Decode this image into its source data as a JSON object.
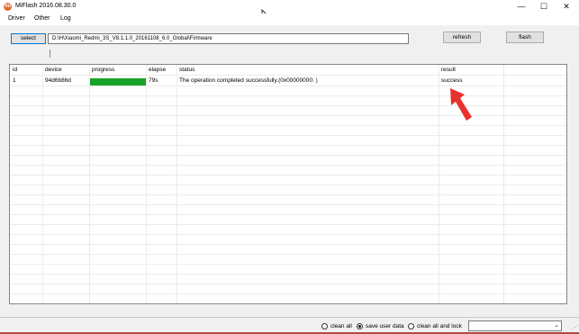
{
  "window": {
    "title": "MiFlash 2016.08.30.0",
    "icon": "mi-logo-icon",
    "controls": {
      "minimize": "—",
      "maximize": "☐",
      "close": "✕"
    }
  },
  "menu": {
    "items": [
      "Driver",
      "Other",
      "Log"
    ]
  },
  "toolbar": {
    "select_label": "select",
    "path_value": "D:\\H\\Xiaomi_Redmi_3S_V8.1.1.0_20161108_6.0_Global\\Firmware",
    "refresh_label": "refresh",
    "flash_label": "flash"
  },
  "table": {
    "columns": [
      "id",
      "device",
      "progress",
      "elapse",
      "status",
      "result"
    ],
    "rows": [
      {
        "id": "1",
        "device": "94d6b86d",
        "progress": 1.0,
        "elapse": "79s",
        "status": "The operation completed successfully.(0x00000000: )",
        "result": "success"
      }
    ]
  },
  "options": {
    "clean_all": "clean all",
    "save_user_data": "save user data",
    "clean_all_and_lock": "clean all and lock",
    "selected": "save user data"
  },
  "colors": {
    "progress_fill": "#1aa32a",
    "arrow": "#e8322e",
    "accent_border": "#0078d7"
  }
}
